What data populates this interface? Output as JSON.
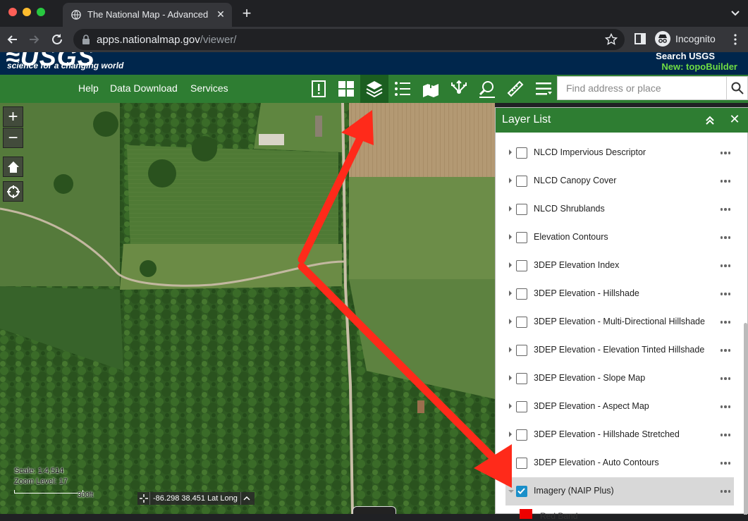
{
  "browser": {
    "tab_title": "The National Map - Advanced V",
    "url_host": "apps.nationalmap.gov",
    "url_path": "/viewer/",
    "profile_label": "Incognito"
  },
  "usgs": {
    "logo_text": "≈USGS",
    "tagline": "science for a changing world",
    "search_link": "Search USGS",
    "topo_link": "New: topoBuilder"
  },
  "nav": {
    "links": [
      "Help",
      "Data Download",
      "Services"
    ],
    "search_placeholder": "Find address or place"
  },
  "map": {
    "scale": "Scale: 1:4,514",
    "zoom_level": "Zoom Level: 17",
    "scale_bar_label": "300ft",
    "coordinates": "-86.298 38.451 Lat Long"
  },
  "layer_panel": {
    "title": "Layer List",
    "layers": [
      {
        "label": "NLCD Impervious Descriptor",
        "checked": false
      },
      {
        "label": "NLCD Canopy Cover",
        "checked": false
      },
      {
        "label": "NLCD Shrublands",
        "checked": false
      },
      {
        "label": "Elevation Contours",
        "checked": false
      },
      {
        "label": "3DEP Elevation Index",
        "checked": false
      },
      {
        "label": "3DEP Elevation - Hillshade",
        "checked": false
      },
      {
        "label": "3DEP Elevation - Multi-Directional Hillshade",
        "checked": false
      },
      {
        "label": "3DEP Elevation - Elevation Tinted Hillshade",
        "checked": false
      },
      {
        "label": "3DEP Elevation - Slope Map",
        "checked": false
      },
      {
        "label": "3DEP Elevation - Aspect Map",
        "checked": false
      },
      {
        "label": "3DEP Elevation - Hillshade Stretched",
        "checked": false
      },
      {
        "label": "3DEP Elevation - Auto Contours",
        "checked": false
      },
      {
        "label": "Imagery (NAIP Plus)",
        "checked": true
      }
    ],
    "legend_label": "Red Band"
  },
  "colors": {
    "usgs_navy": "#00264c",
    "nav_green": "#2e7d32",
    "annotation_red": "#ff2a1a"
  }
}
